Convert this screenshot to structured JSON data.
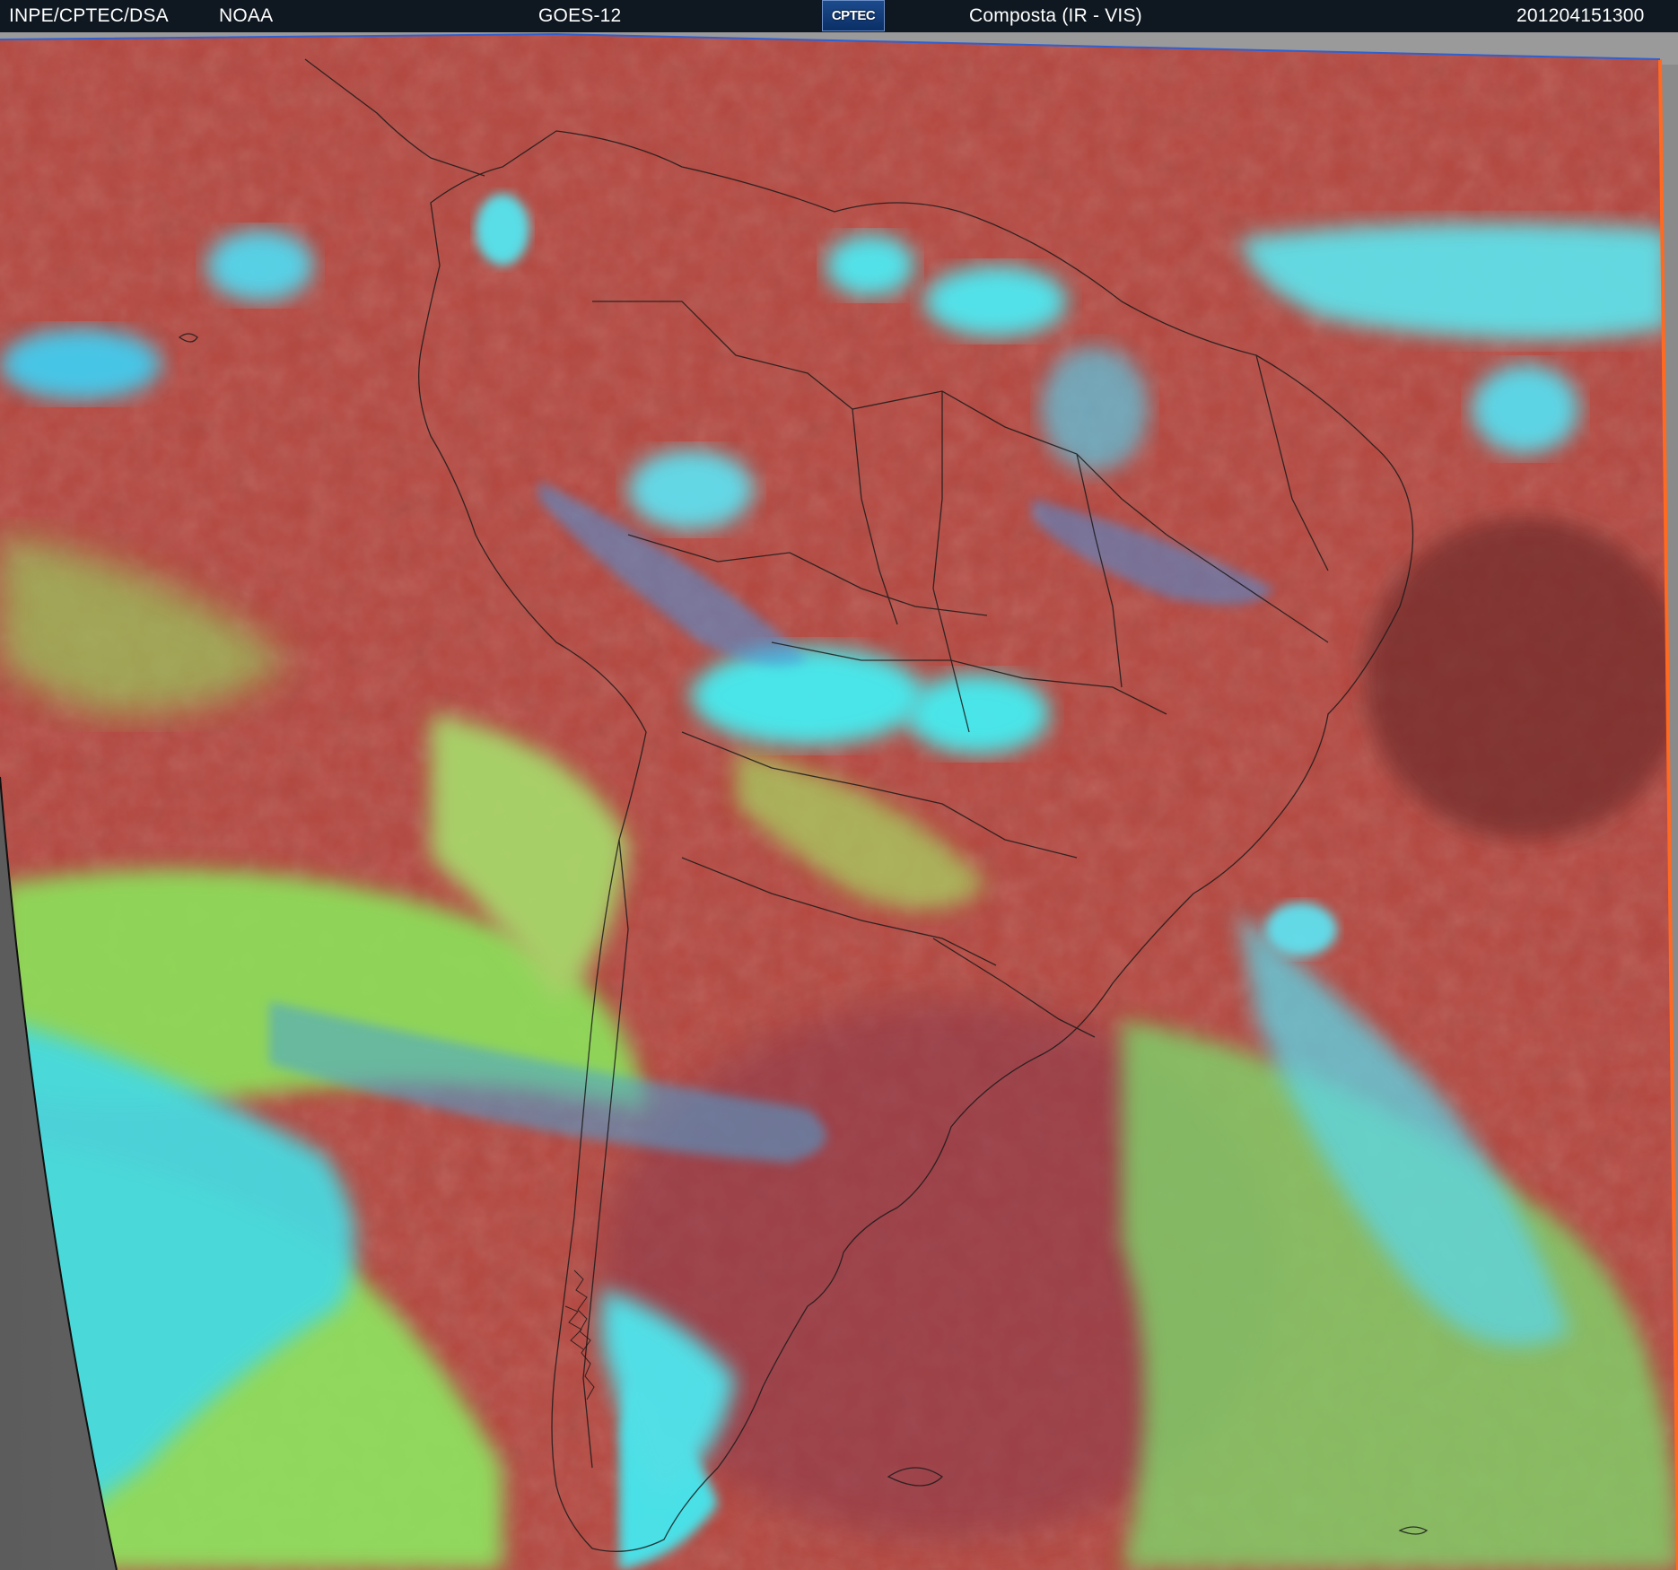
{
  "header": {
    "agency": "INPE/CPTEC/DSA",
    "source": "NOAA",
    "satellite": "GOES-12",
    "logo_text": "CPTEC",
    "product": "Composta (IR - VIS)",
    "timestamp": "201204151300"
  },
  "colors": {
    "ocean_clear": "#b9473f",
    "land_clear": "#a84a3f",
    "cloud_low": "#8fdc5a",
    "cloud_high": "#3fe6f0",
    "cloud_mid": "#3f9fe0",
    "space_gray": "#6e6e6e",
    "header_bg": "#0f1720"
  }
}
